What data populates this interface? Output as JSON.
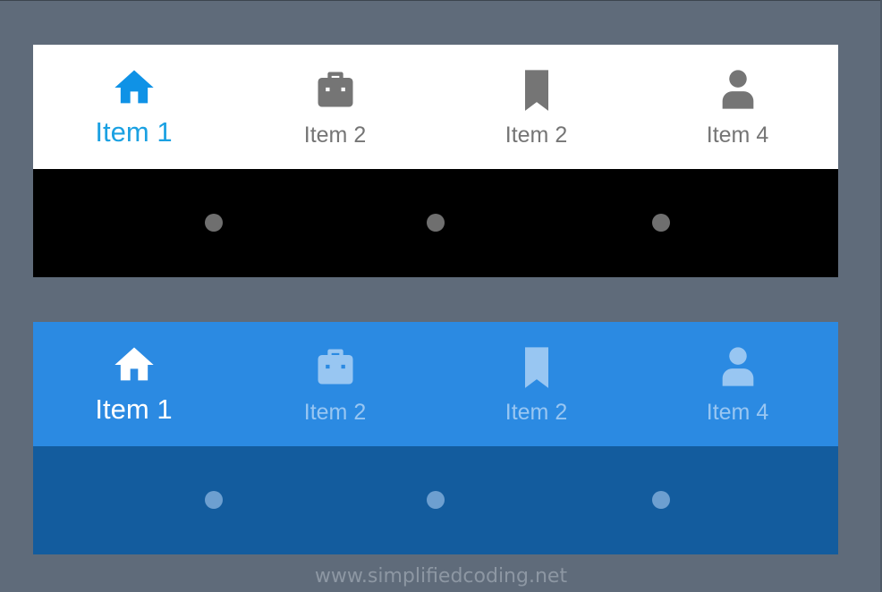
{
  "demos": [
    {
      "theme": "light",
      "items": [
        {
          "label": "Item 1",
          "icon": "home-icon",
          "active": true
        },
        {
          "label": "Item 2",
          "icon": "briefcase-icon",
          "active": false
        },
        {
          "label": "Item 2",
          "icon": "bookmark-icon",
          "active": false
        },
        {
          "label": "Item 4",
          "icon": "person-icon",
          "active": false
        }
      ],
      "colors": {
        "bar": "#ffffff",
        "strip": "#000000",
        "active": "#1ba1e2",
        "inactive": "#757575",
        "dot": "#6f6f6f"
      }
    },
    {
      "theme": "blue",
      "items": [
        {
          "label": "Item 1",
          "icon": "home-icon",
          "active": true
        },
        {
          "label": "Item 2",
          "icon": "briefcase-icon",
          "active": false
        },
        {
          "label": "Item 2",
          "icon": "bookmark-icon",
          "active": false
        },
        {
          "label": "Item 4",
          "icon": "person-icon",
          "active": false
        }
      ],
      "colors": {
        "bar": "#2b8ae2",
        "strip": "#135c9e",
        "active": "#ffffff",
        "inactive": "#98c6f2",
        "dot": "#6d9fd0"
      }
    }
  ],
  "watermark": "www.simplifiedcoding.net",
  "background_color": "#5f6b7a"
}
